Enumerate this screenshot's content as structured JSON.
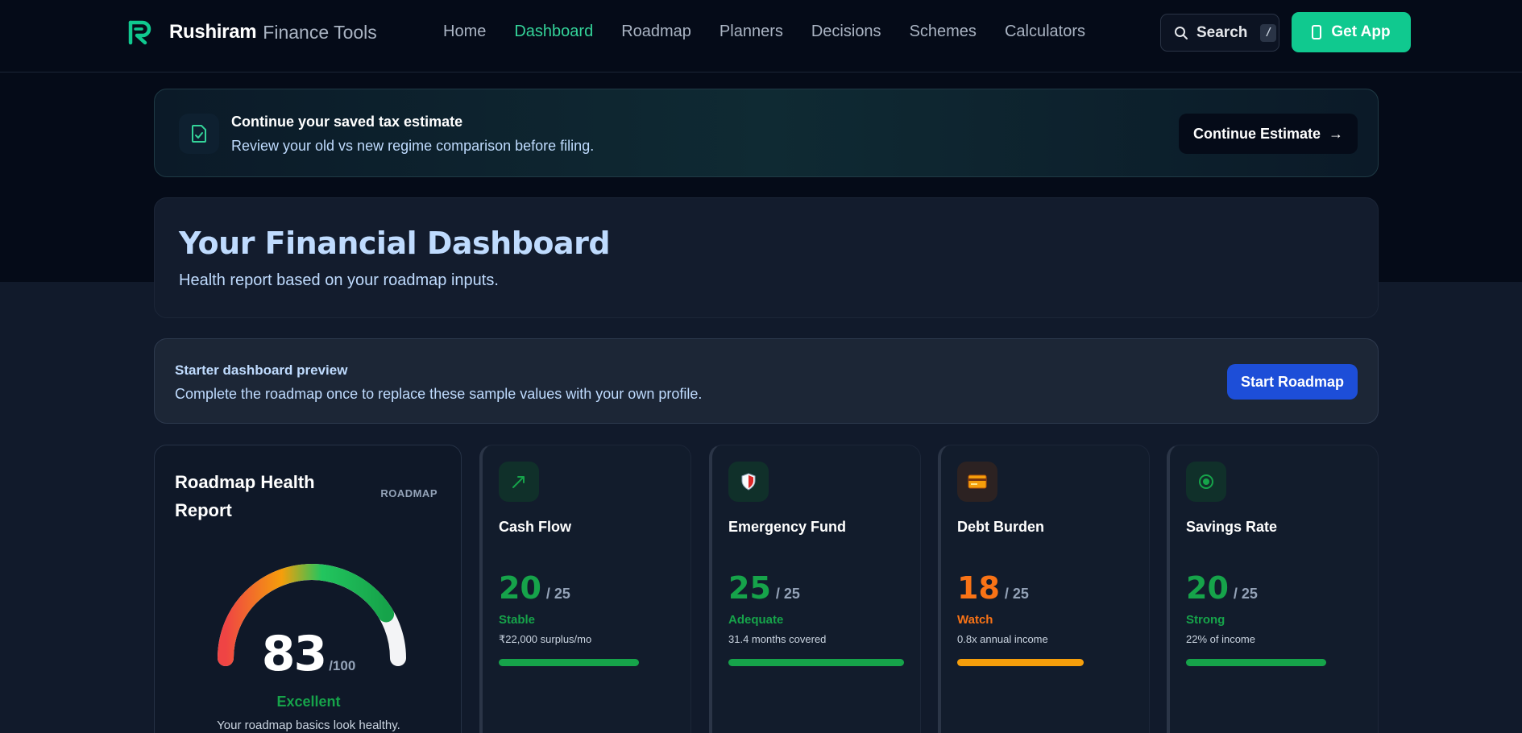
{
  "nav": {
    "brand": "Rushiram",
    "brand_sub": "Finance Tools",
    "links": [
      "Home",
      "Dashboard",
      "Roadmap",
      "Planners",
      "Decisions",
      "Schemes",
      "Calculators"
    ],
    "active": "Dashboard",
    "search_label": "Search",
    "search_shortcut": "/",
    "get_app_label": "Get App"
  },
  "banner": {
    "icon": "document-check-icon",
    "title": "Continue your saved tax estimate",
    "subtitle": "Review your old vs new regime comparison before filing.",
    "button_label": "Continue Estimate",
    "button_arrow": "→"
  },
  "header": {
    "title": "Your Financial Dashboard",
    "subtitle": "Health report based on your roadmap inputs."
  },
  "starter": {
    "title": "Starter dashboard preview",
    "subtitle": "Complete the roadmap once to replace these sample values with your own profile.",
    "button_label": "Start Roadmap"
  },
  "health": {
    "title": "Roadmap Health Report",
    "tag": "ROADMAP",
    "score": "83",
    "score_max": "/100",
    "score_fraction": 0.83,
    "status": "Excellent",
    "note": "Your roadmap basics look healthy."
  },
  "metrics": [
    {
      "name": "Cash Flow",
      "icon": "trending-up-icon",
      "score": "20",
      "max": "/ 25",
      "status": "Stable",
      "detail": "₹22,000 surplus/mo",
      "fraction": 0.8,
      "color": "#16a34a",
      "icon_bg": "#10302a"
    },
    {
      "name": "Emergency Fund",
      "icon": "shield-icon",
      "score": "25",
      "max": "/ 25",
      "status": "Adequate",
      "detail": "31.4 months covered",
      "fraction": 1.0,
      "color": "#16a34a",
      "icon_bg": "#10302a"
    },
    {
      "name": "Debt Burden",
      "icon": "credit-card-icon",
      "score": "18",
      "max": "/ 25",
      "status": "Watch",
      "detail": "0.8x annual income",
      "fraction": 0.72,
      "color": "#f59e0b",
      "status_color": "#f97316",
      "icon_bg": "#2c2222"
    },
    {
      "name": "Savings Rate",
      "icon": "target-icon",
      "score": "20",
      "max": "/ 25",
      "status": "Strong",
      "detail": "22% of income",
      "fraction": 0.8,
      "color": "#16a34a",
      "icon_bg": "#10302a"
    }
  ]
}
